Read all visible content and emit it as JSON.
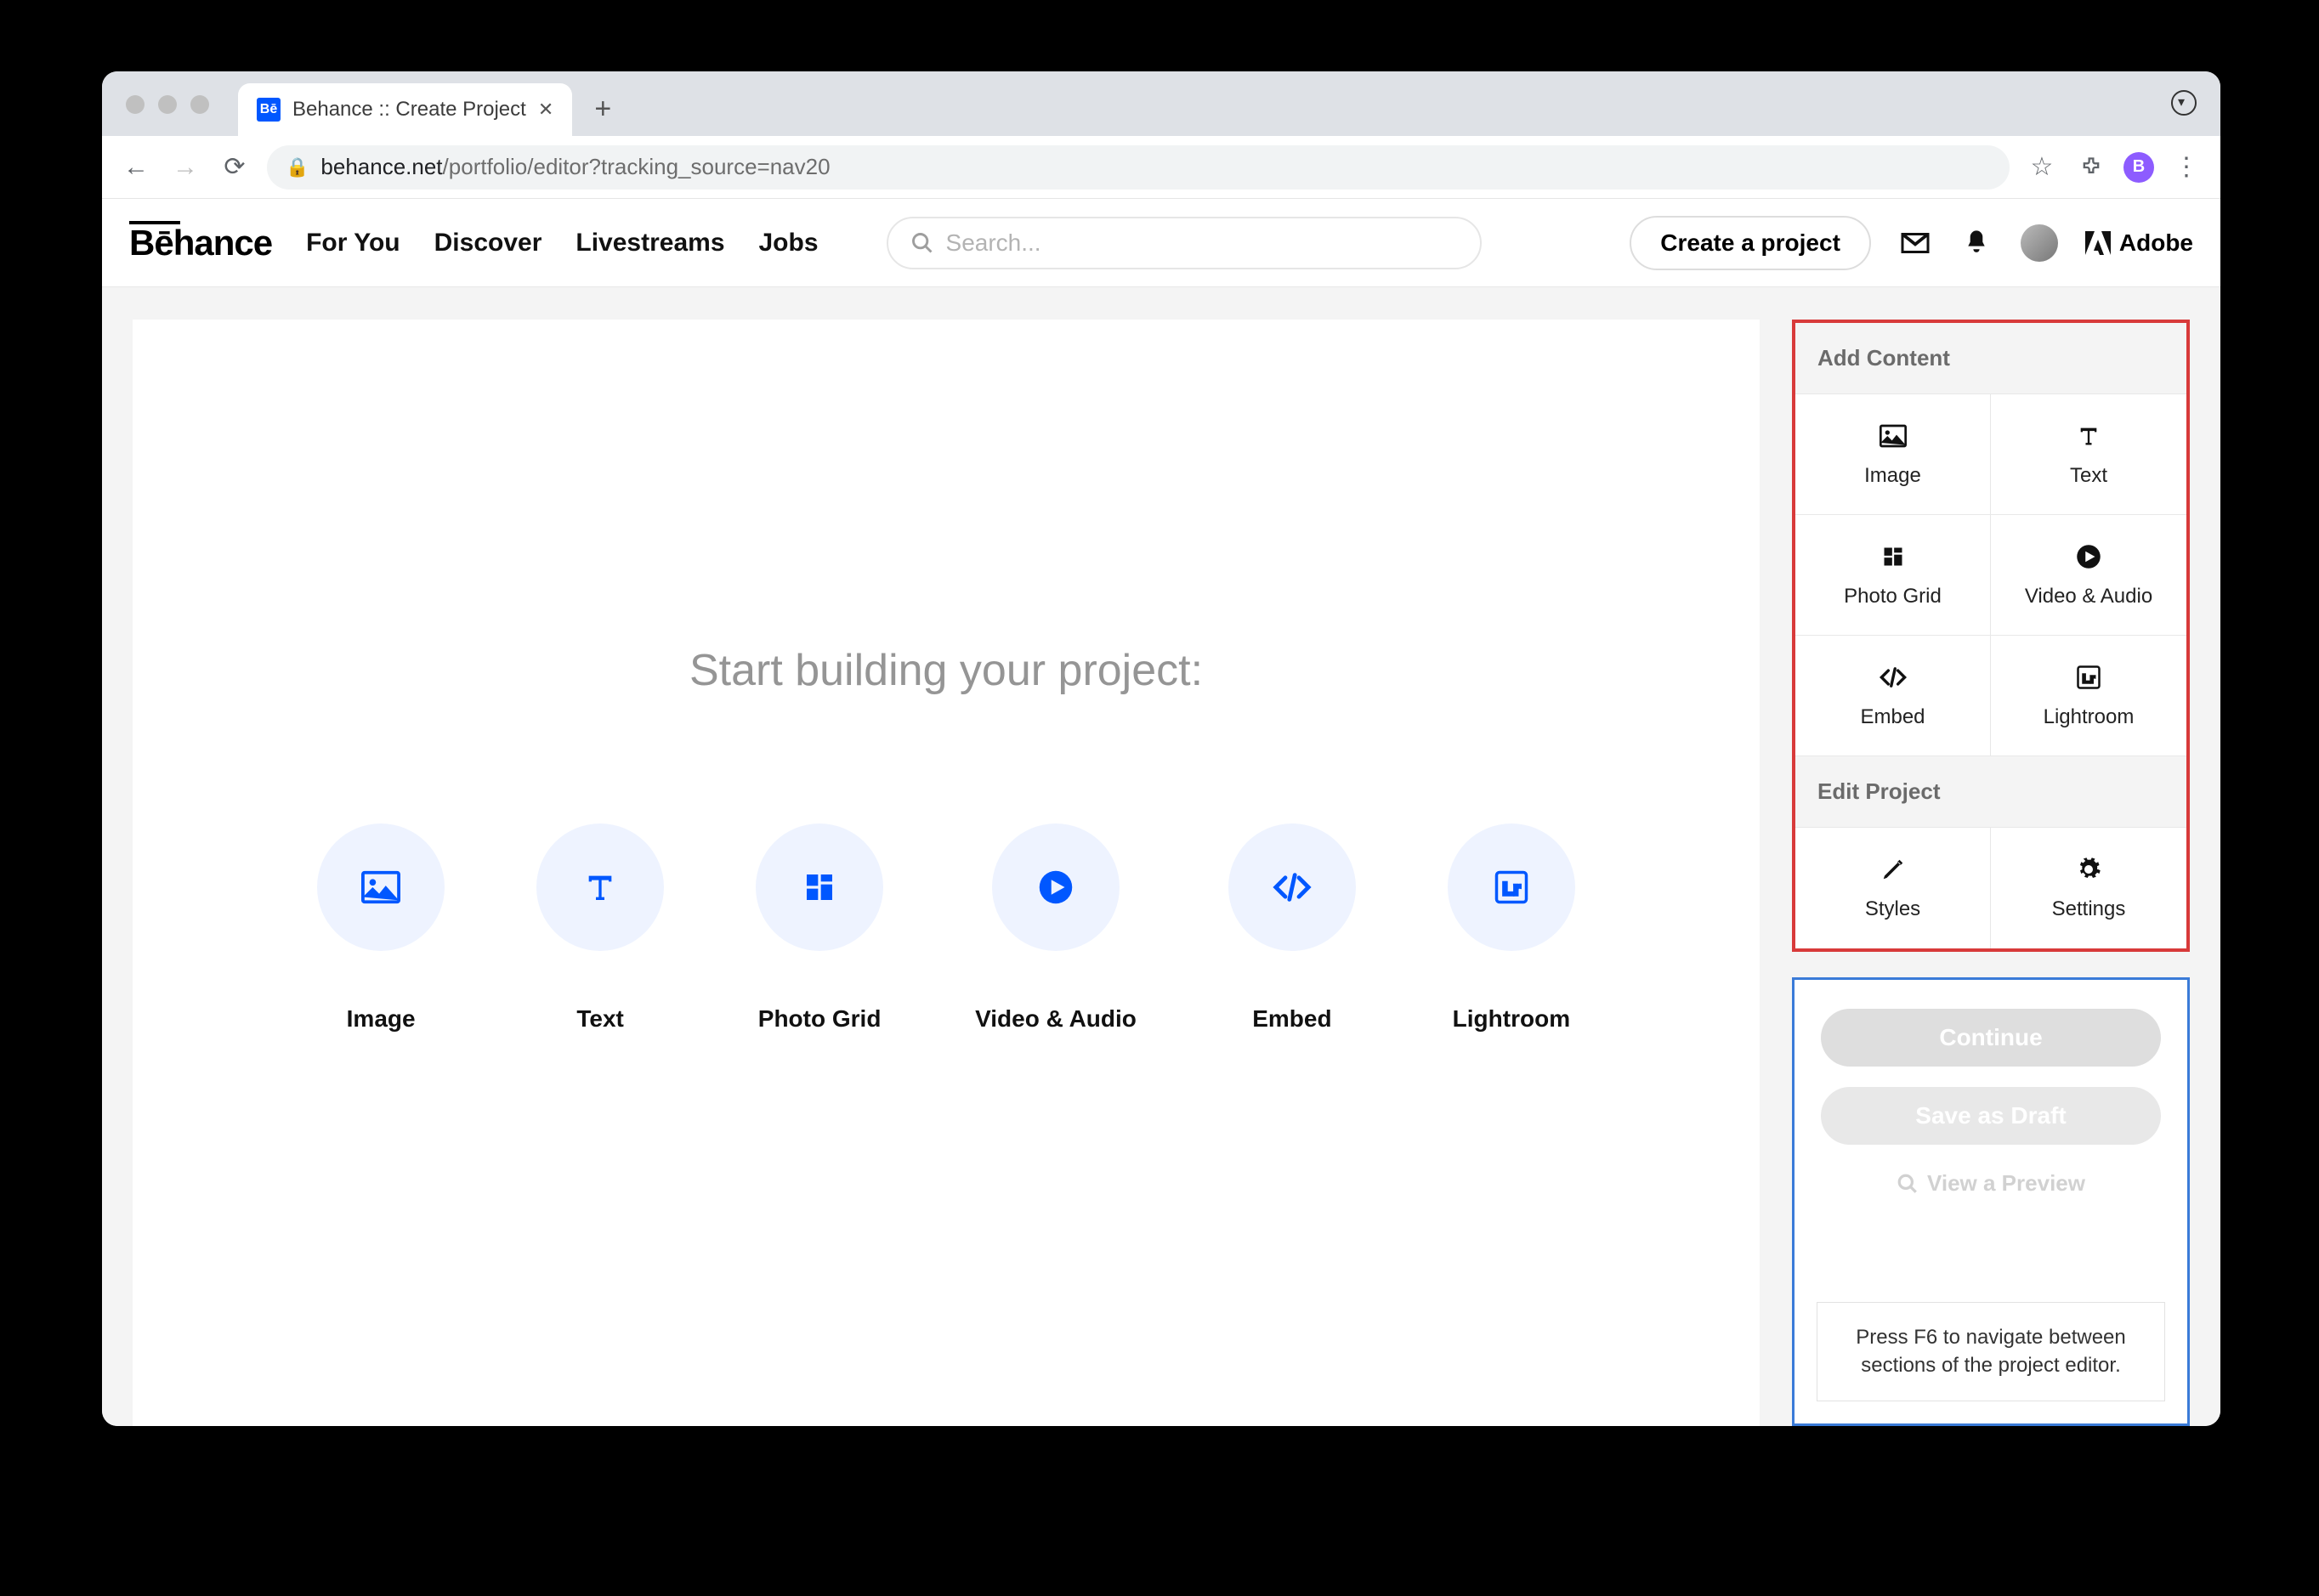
{
  "browser": {
    "tab_title": "Behance :: Create Project",
    "url_host": "behance.net",
    "url_path": "/portfolio/editor?tracking_source=nav20",
    "profile_initial": "B"
  },
  "header": {
    "logo": "Bēhance",
    "nav": [
      "For You",
      "Discover",
      "Livestreams",
      "Jobs"
    ],
    "search_placeholder": "Search...",
    "create_button": "Create a project",
    "adobe": "Adobe"
  },
  "canvas": {
    "title": "Start building your project:",
    "blocks": [
      {
        "id": "image",
        "label": "Image"
      },
      {
        "id": "text",
        "label": "Text"
      },
      {
        "id": "photo-grid",
        "label": "Photo Grid"
      },
      {
        "id": "video-audio",
        "label": "Video & Audio"
      },
      {
        "id": "embed",
        "label": "Embed"
      },
      {
        "id": "lightroom",
        "label": "Lightroom"
      }
    ]
  },
  "panel": {
    "add_content_header": "Add Content",
    "edit_project_header": "Edit Project",
    "tiles_add": [
      {
        "id": "image",
        "label": "Image"
      },
      {
        "id": "text",
        "label": "Text"
      },
      {
        "id": "photo-grid",
        "label": "Photo Grid"
      },
      {
        "id": "video-audio",
        "label": "Video & Audio"
      },
      {
        "id": "embed",
        "label": "Embed"
      },
      {
        "id": "lightroom",
        "label": "Lightroom"
      }
    ],
    "tiles_edit": [
      {
        "id": "styles",
        "label": "Styles"
      },
      {
        "id": "settings",
        "label": "Settings"
      }
    ]
  },
  "actions": {
    "continue": "Continue",
    "save_draft": "Save as Draft",
    "preview": "View a Preview",
    "hint": "Press F6 to navigate between sections of the project editor."
  }
}
